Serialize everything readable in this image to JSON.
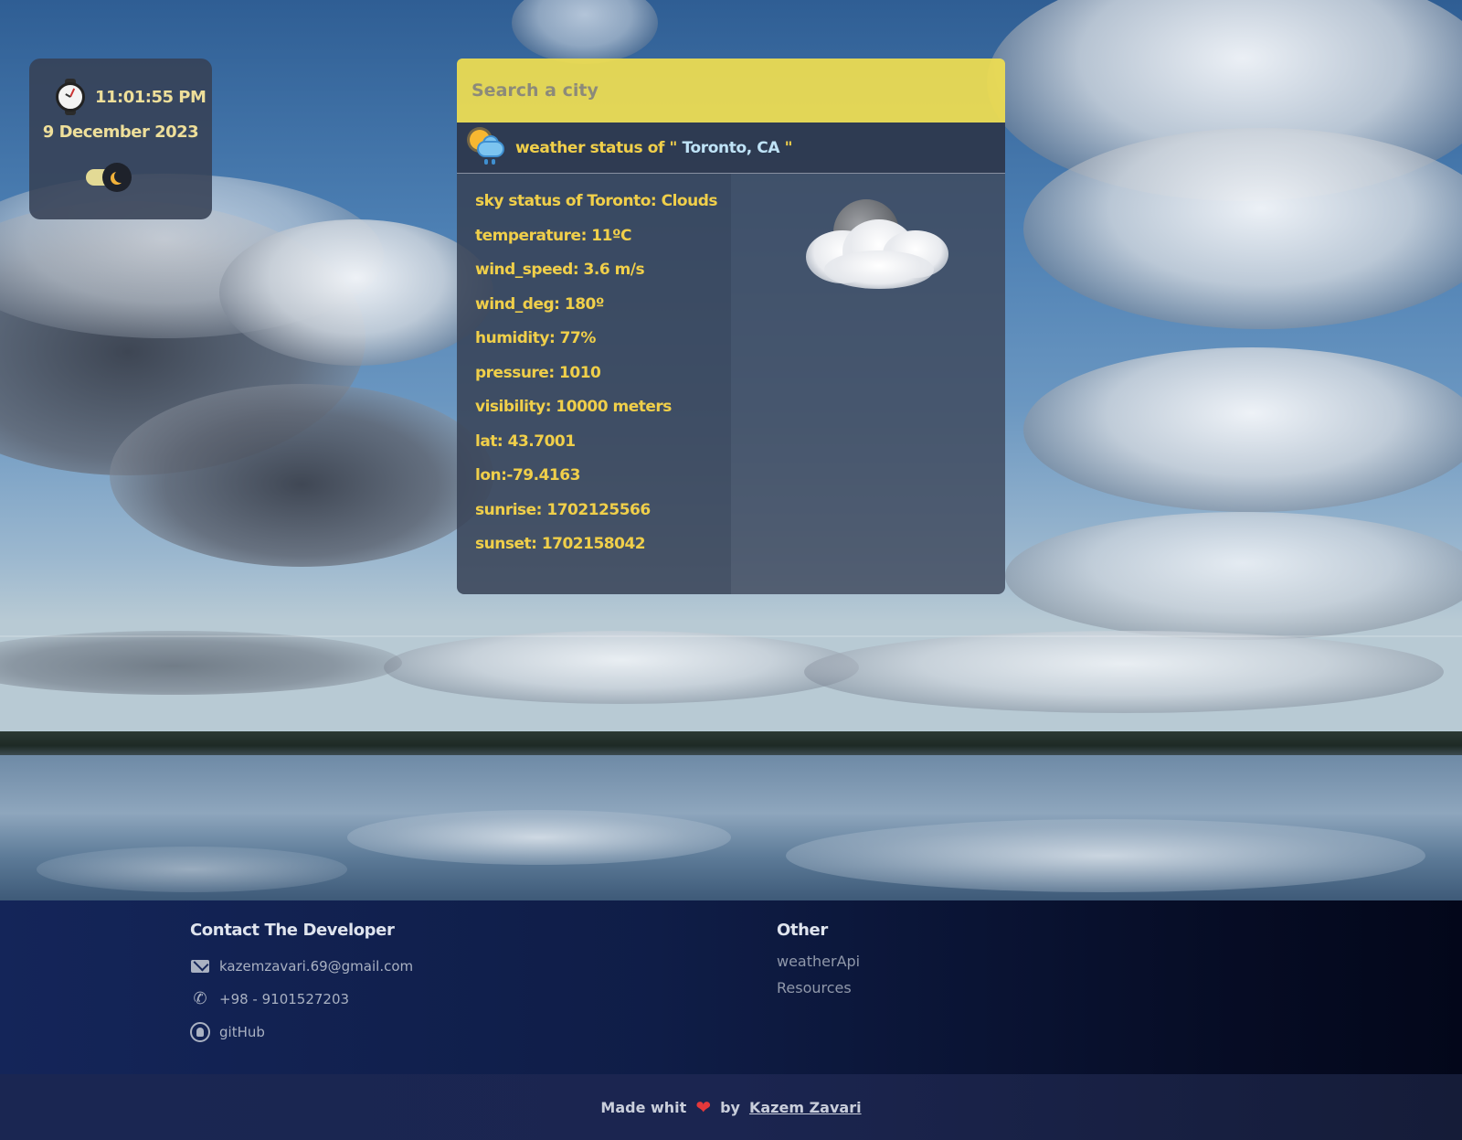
{
  "clock": {
    "time": "11:01:55 PM",
    "date": "9 December 2023",
    "watch_icon": "watch-icon",
    "theme_toggle_icon": "moon-icon"
  },
  "search": {
    "placeholder": "Search a city",
    "value": ""
  },
  "status": {
    "prefix": "weather status of \"",
    "city": " Toronto, CA ",
    "suffix": "\"",
    "icon": "sun-cloud-rain-icon"
  },
  "details": [
    "sky status of Toronto: Clouds",
    "temperature: 11ºC",
    "wind_speed: 3.6 m/s",
    "wind_deg: 180º",
    "humidity: 77%",
    "pressure: 1010",
    "visibility: 10000 meters",
    "lat: 43.7001",
    "lon:-79.4163",
    "sunrise: 1702125566",
    "sunset: 1702158042"
  ],
  "weather_image": "moon-cloud-icon",
  "footer": {
    "contact_title": "Contact The Developer",
    "email": "kazemzavari.69@gmail.com",
    "phone": "+98 - 9101527203",
    "github": "gitHub",
    "other_title": "Other",
    "other_links": [
      "weatherApi",
      "Resources"
    ]
  },
  "credits": {
    "made": "Made whit",
    "by": "by",
    "author": "Kazem Zavari",
    "heart_icon": "heart-icon"
  },
  "colors": {
    "accent_yellow": "#f0cf4a",
    "search_bg": "#f0de50",
    "city_blue": "#bfe3f7",
    "heart": "#e5383b"
  }
}
